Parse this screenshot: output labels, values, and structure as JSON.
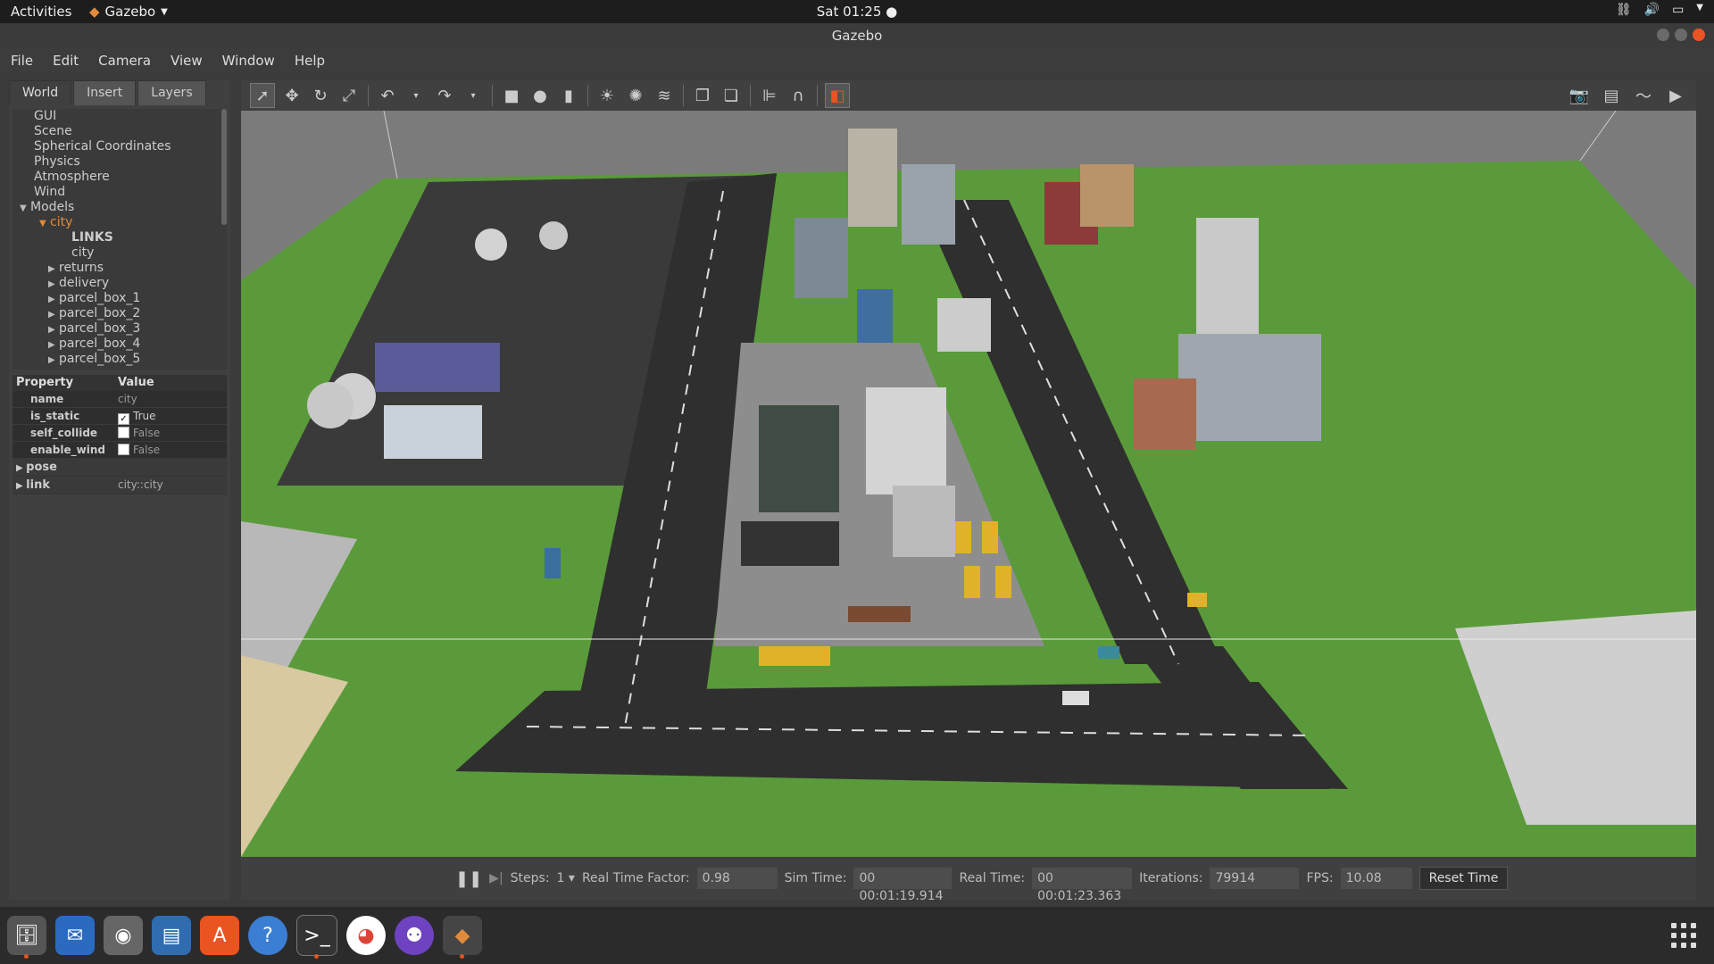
{
  "topbar": {
    "activities": "Activities",
    "app_name": "Gazebo",
    "clock": "Sat 01:25"
  },
  "window": {
    "title": "Gazebo"
  },
  "menu": [
    "File",
    "Edit",
    "Camera",
    "View",
    "Window",
    "Help"
  ],
  "left_panel": {
    "tabs": [
      "World",
      "Insert",
      "Layers"
    ],
    "tree": {
      "gui": "GUI",
      "scene": "Scene",
      "spherical": "Spherical Coordinates",
      "physics": "Physics",
      "atmosphere": "Atmosphere",
      "wind": "Wind",
      "models": "Models",
      "city": "city",
      "links": "LINKS",
      "city_link": "city",
      "returns": "returns",
      "delivery": "delivery",
      "pb1": "parcel_box_1",
      "pb2": "parcel_box_2",
      "pb3": "parcel_box_3",
      "pb4": "parcel_box_4",
      "pb5": "parcel_box_5"
    },
    "properties": {
      "col_property": "Property",
      "col_value": "Value",
      "name_k": "name",
      "name_v": "city",
      "static_k": "is_static",
      "static_v": "True",
      "collide_k": "self_collide",
      "collide_v": "False",
      "wind_k": "enable_wind",
      "wind_v": "False",
      "pose_k": "pose",
      "link_k": "link",
      "link_v": "city::city"
    }
  },
  "bottom": {
    "steps_label": "Steps:",
    "steps_value": "1",
    "rtf_label": "Real Time Factor:",
    "rtf_value": "0.98",
    "sim_label": "Sim Time:",
    "sim_value": "00 00:01:19.914",
    "real_label": "Real Time:",
    "real_value": "00 00:01:23.363",
    "iter_label": "Iterations:",
    "iter_value": "79914",
    "fps_label": "FPS:",
    "fps_value": "10.08",
    "reset": "Reset Time"
  },
  "colors": {
    "accent": "#e95420",
    "selected_tree": "#e08a3c",
    "grass": "#5a9a3a",
    "road": "#2f2f2f"
  }
}
